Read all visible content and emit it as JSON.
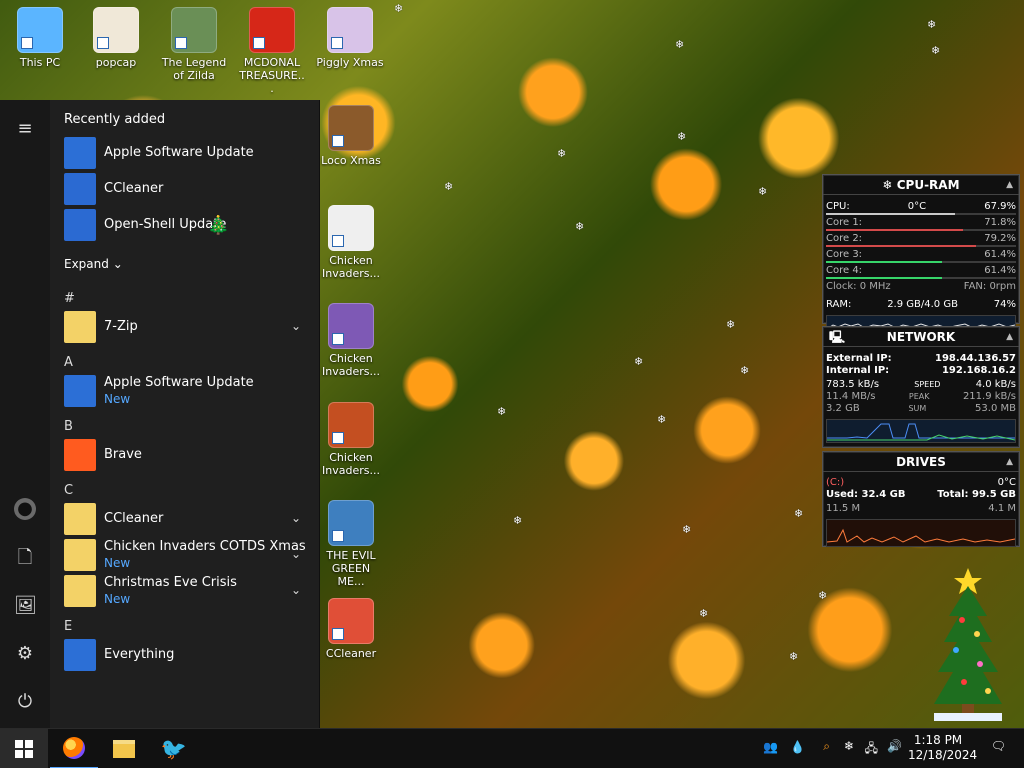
{
  "desktop_icons": [
    {
      "label": "This PC",
      "icon": "computer-icon",
      "color": "#5bb5ff"
    },
    {
      "label": "popcap",
      "icon": "folder-document-icon",
      "color": "#f0e8d8"
    },
    {
      "label": "The Legend of Zilda",
      "icon": "game-character-icon",
      "color": "#6a8f56"
    },
    {
      "label": "MCDONAL TREASURE...",
      "icon": "mcdonalds-logo-icon",
      "color": "#d62718"
    },
    {
      "label": "Piggly Xmas",
      "icon": "pig-icon",
      "color": "#d8c3e8"
    },
    {
      "label": "Loco Xmas",
      "icon": "teddy-bear-icon",
      "color": "#8b5a2b"
    },
    {
      "label": "Chicken Invaders...",
      "icon": "chicken-icon",
      "color": "#efefef"
    },
    {
      "label": "Chicken Invaders...",
      "icon": "chicken-icon",
      "color": "#7e59b5"
    },
    {
      "label": "Chicken Invaders...",
      "icon": "chicken-icon",
      "color": "#c44f21"
    },
    {
      "label": "THE EVIL GREEN ME...",
      "icon": "green-game-icon",
      "color": "#3e7fbf"
    },
    {
      "label": "CCleaner",
      "icon": "broom-icon",
      "color": "#e04f37"
    }
  ],
  "start_menu": {
    "recently_added_title": "Recently added",
    "recently_added": [
      {
        "label": "Apple Software Update",
        "icon": "apple-update-icon",
        "color": "#2c6fd6"
      },
      {
        "label": "CCleaner",
        "icon": "broom-icon",
        "color": "#2b6ad2"
      },
      {
        "label": "Open-Shell Update",
        "icon": "shell-icon",
        "color": "#2b6ad2"
      }
    ],
    "expand_label": "Expand",
    "sections": [
      {
        "letter": "#",
        "items": [
          {
            "label": "7-Zip",
            "sub": "",
            "icon": "folder-icon",
            "color": "#f3d267",
            "chevron": "⌄"
          }
        ]
      },
      {
        "letter": "A",
        "items": [
          {
            "label": "Apple Software Update",
            "sub": "New",
            "icon": "apple-update-icon",
            "color": "#2c6fd6",
            "chevron": ""
          }
        ]
      },
      {
        "letter": "B",
        "items": [
          {
            "label": "Brave",
            "sub": "",
            "icon": "brave-icon",
            "color": "#ff5b1f",
            "chevron": ""
          }
        ]
      },
      {
        "letter": "C",
        "items": [
          {
            "label": "CCleaner",
            "sub": "",
            "icon": "folder-icon",
            "color": "#f3d267",
            "chevron": "⌄"
          },
          {
            "label": "Chicken Invaders COTDS Xmas",
            "sub": "New",
            "icon": "folder-icon",
            "color": "#f3d267",
            "chevron": "⌄"
          },
          {
            "label": "Christmas Eve Crisis",
            "sub": "New",
            "icon": "folder-icon",
            "color": "#f3d267",
            "chevron": "⌄"
          }
        ]
      },
      {
        "letter": "E",
        "items": [
          {
            "label": "Everything",
            "sub": "",
            "icon": "search-icon",
            "color": "#2c6fd6",
            "chevron": ""
          }
        ]
      }
    ]
  },
  "cpu_ram": {
    "title": "CPU-RAM",
    "cpu_label": "CPU:",
    "cpu_temp": "0°C",
    "cpu_pct": "67.9%",
    "cores": [
      {
        "label": "Core 1:",
        "value": "71.8%",
        "fill": 0.72
      },
      {
        "label": "Core 2:",
        "value": "79.2%",
        "fill": 0.79
      },
      {
        "label": "Core 3:",
        "value": "61.4%",
        "fill": 0.61
      },
      {
        "label": "Core 4:",
        "value": "61.4%",
        "fill": 0.61
      }
    ],
    "clock": "Clock: 0 MHz",
    "fan": "FAN: 0rpm",
    "ram_label": "RAM:",
    "ram_value": "2.9 GB/4.0 GB",
    "ram_pct": "74%"
  },
  "network": {
    "title": "NETWORK",
    "external_label": "External IP:",
    "external_value": "198.44.136.57",
    "internal_label": "Internal IP:",
    "internal_value": "192.168.16.2",
    "speed_left": "783.5 kB/s",
    "speed_mid": "SPEED",
    "speed_right": "4.0 kB/s",
    "peak_left": "11.4 MB/s",
    "peak_mid": "PEAK",
    "peak_right": "211.9 kB/s",
    "sum_left": "3.2 GB",
    "sum_mid": "SUM",
    "sum_right": "53.0 MB"
  },
  "drives": {
    "title": "DRIVES",
    "drive": "(C:)",
    "temp": "0°C",
    "used": "Used: 32.4 GB",
    "total": "Total: 99.5 GB",
    "read": "11.5 M",
    "write": "4.1 M"
  },
  "taskbar": {
    "apps": [
      {
        "name": "windows-start-icon",
        "color": "#ffffff"
      },
      {
        "name": "firefox-icon",
        "color": "#ff7b00"
      },
      {
        "name": "file-explorer-icon",
        "color": "#f2c54b"
      },
      {
        "name": "bird-icon",
        "color": "#5da7ff"
      }
    ],
    "time": "1:18 PM",
    "date": "12/18/2024"
  }
}
